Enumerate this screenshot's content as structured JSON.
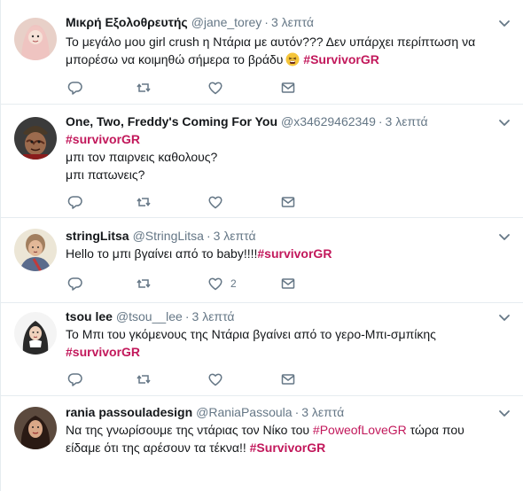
{
  "tweets": [
    {
      "fullname": "Μικρή Εξολοθρευτής",
      "handle": "@jane_torey",
      "time": "3 λεπτά",
      "line1": "Το μεγάλο μου girl crush η Ντάρια με αυτόν??? Δεν υπάρχει περίπτωση να",
      "line2": "μπορέσω να κοιμηθώ σήμερα το βράδυ",
      "hashtag": "#SurvivorGR",
      "emoji": "tired-face-emoji"
    },
    {
      "fullname": "One, Two, Freddy's Coming For You",
      "handle": "@x34629462349",
      "time": "3 λεπτά",
      "hashtag": "#survivorGR",
      "line1": "μπι τον παιρνεις καθολους?",
      "line2": "μπι πατωνεις?"
    },
    {
      "fullname": "stringLitsa",
      "handle": "@StringLitsa",
      "time": "3 λεπτά",
      "line1": "Hello το μπι βγαίνει από το  baby!!!!",
      "hashtag": "#survivorGR",
      "like_count": "2"
    },
    {
      "fullname": "tsou lee",
      "handle": "@tsou__lee",
      "time": "3 λεπτά",
      "line1": "Το Μπι του γκόμενους της Ντάρια βγαίνει από το γερο-Μπι-σμπίκης",
      "hashtag": "#survivorGR"
    },
    {
      "fullname": "rania passouladesign",
      "handle": "@RaniaPassoula",
      "time": "3 λεπτά",
      "line1_pre": "Να της γνωρίσουμε της ντάριας τον Νίκο του ",
      "line1_tag": "#PoweofLoveGR",
      "line1_post": " τώρα που",
      "line2": "είδαμε ότι της αρέσουν τα τέκνα!!  ",
      "hashtag": "#SurvivorGR"
    }
  ],
  "icons": {
    "reply": "reply-icon",
    "retweet": "retweet-icon",
    "like": "heart-icon",
    "dm": "envelope-icon",
    "caret": "chevron-down-icon"
  },
  "colors": {
    "hashtag": "#c2185b",
    "secondary_text": "#657786",
    "icon": "#657786",
    "divider": "#e6ecf0"
  }
}
